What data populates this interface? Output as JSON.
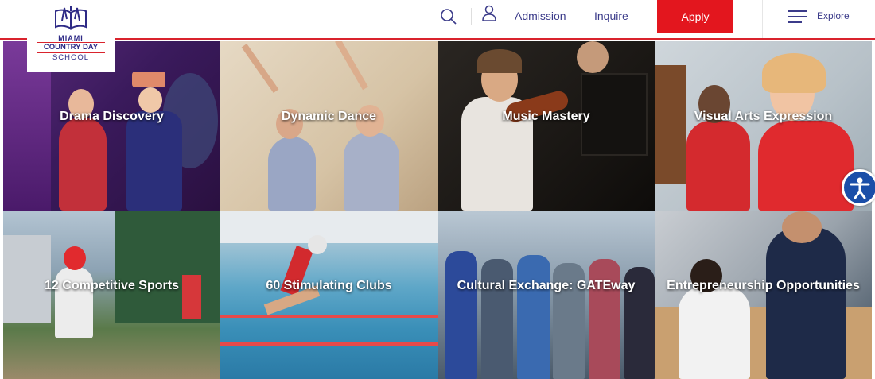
{
  "logo": {
    "line1": "MIAMI",
    "line2": "COUNTRY DAY",
    "line3": "SCHOOL"
  },
  "nav": {
    "search_icon": "search-icon",
    "user_icon": "user-icon",
    "admission": "Admission",
    "inquire": "Inquire",
    "apply": "Apply",
    "menu_icon": "hamburger-menu-icon",
    "explore": "Explore"
  },
  "tiles": [
    {
      "label": "Drama Discovery"
    },
    {
      "label": "Dynamic Dance"
    },
    {
      "label": "Music Mastery"
    },
    {
      "label": "Visual Arts Expression"
    },
    {
      "label": "12 Competitive Sports"
    },
    {
      "label": "60 Stimulating Clubs"
    },
    {
      "label": "Cultural Exchange: GATEway"
    },
    {
      "label": "Entrepreneurship Opportunities"
    }
  ],
  "accessibility": {
    "icon": "accessibility-icon"
  },
  "colors": {
    "brand_blue": "#2e2a86",
    "apply_red": "#e3161e",
    "accent_red": "#d9232d"
  }
}
